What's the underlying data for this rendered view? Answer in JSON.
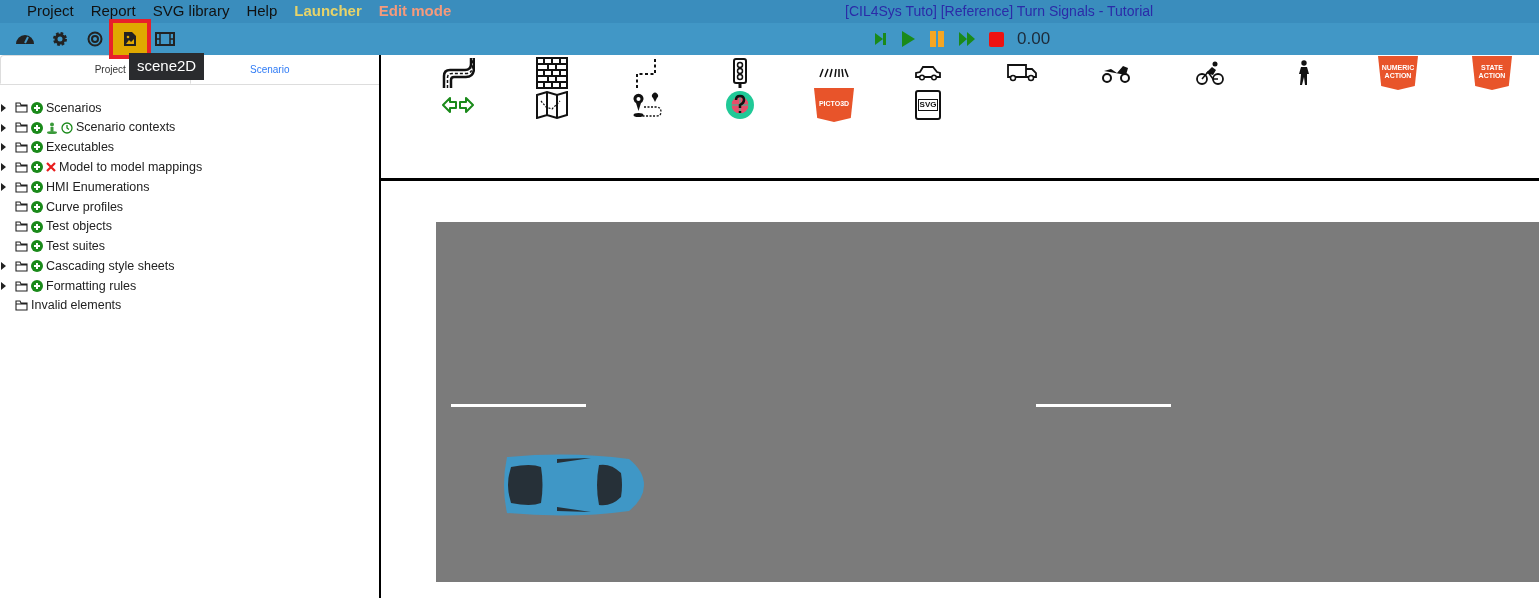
{
  "menu": [
    {
      "label": "Project",
      "kind": "plain"
    },
    {
      "label": "Report",
      "kind": "plain"
    },
    {
      "label": "SVG library",
      "kind": "plain"
    },
    {
      "label": "Help",
      "kind": "plain"
    },
    {
      "label": "Launcher",
      "kind": "launcher"
    },
    {
      "label": "Edit mode",
      "kind": "editmode"
    }
  ],
  "window": {
    "title": "[CIL4Sys Tuto] [Reference] Turn Signals - Tutorial"
  },
  "toolbar": [
    {
      "kind": "dashboard",
      "selected": false
    },
    {
      "kind": "gear",
      "selected": false
    },
    {
      "kind": "target",
      "selected": false
    },
    {
      "kind": "image",
      "selected": true
    },
    {
      "kind": "film",
      "selected": false
    }
  ],
  "tooltip": "scene2D",
  "playback": {
    "time": "0.00"
  },
  "tabs": [
    {
      "label": "Project",
      "selected": true
    },
    {
      "label": "Scenario",
      "selected": false
    }
  ],
  "tree": [
    {
      "label": "Scenarios",
      "expandable": true,
      "addable": true
    },
    {
      "label": "Scenario contexts",
      "expandable": true,
      "addable": true
    },
    {
      "label": "Executables",
      "expandable": true,
      "addable": true
    },
    {
      "label": "Model to model mappings",
      "expandable": true,
      "addable": true
    },
    {
      "label": "HMI Enumerations",
      "expandable": true,
      "addable": true
    },
    {
      "label": "Curve profiles",
      "expandable": false,
      "addable": true
    },
    {
      "label": "Test objects",
      "expandable": false,
      "addable": true
    },
    {
      "label": "Test suites",
      "expandable": false,
      "addable": true
    },
    {
      "label": "Cascading style sheets",
      "expandable": true,
      "addable": true
    },
    {
      "label": "Formatting rules",
      "expandable": true,
      "addable": true
    },
    {
      "label": "Invalid elements",
      "expandable": false,
      "addable": false
    }
  ],
  "palette": [
    {
      "kind": "road"
    },
    {
      "kind": "wall"
    },
    {
      "kind": "path"
    },
    {
      "kind": "light"
    },
    {
      "kind": "crossing"
    },
    {
      "kind": "car"
    },
    {
      "kind": "truck"
    },
    {
      "kind": "moto"
    },
    {
      "kind": "bike"
    },
    {
      "kind": "walker"
    },
    {
      "kind": "shield",
      "label": "NUMERIC ACTION"
    },
    {
      "kind": "shield",
      "label": "STATE ACTION"
    },
    {
      "kind": "arrows"
    },
    {
      "kind": "map"
    },
    {
      "kind": "route"
    },
    {
      "kind": "radar"
    },
    {
      "kind": "shield",
      "label": "PICTO3D"
    },
    {
      "kind": "svgfile",
      "label": "SVG"
    }
  ]
}
